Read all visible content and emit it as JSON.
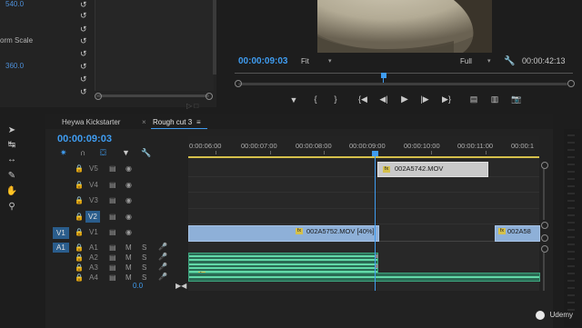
{
  "effect_controls": {
    "rows": [
      {
        "label": "",
        "value": "540.0"
      },
      {
        "label": "",
        "value": ""
      },
      {
        "label": "orm Scale",
        "value": ""
      },
      {
        "label": "",
        "value": ""
      },
      {
        "label": "",
        "value": "360.0"
      },
      {
        "label": "",
        "value": ""
      },
      {
        "label": "",
        "value": ""
      }
    ]
  },
  "program_monitor": {
    "timecode": "00:00:09:03",
    "fit": "Fit",
    "resolution": "Full",
    "duration": "00:00:42:13",
    "controls": [
      "marker-icon",
      "in-point-icon",
      "out-point-icon",
      "go-to-in-icon",
      "step-back-icon",
      "play-icon",
      "step-forward-icon",
      "go-to-out-icon",
      "lift-icon",
      "extract-icon",
      "export-frame-icon"
    ]
  },
  "timeline": {
    "tabs": [
      {
        "label": "Heywa Kickstarter"
      },
      {
        "label": "Rough cut 3"
      }
    ],
    "timecode": "00:00:09:03",
    "ruler": [
      "0:00:06:00",
      "00:00:07:00",
      "00:00:08:00",
      "00:00:09:00",
      "00:00:10:00",
      "00:00:11:00",
      "00:00:1"
    ],
    "video_tracks": [
      "V5",
      "V4",
      "V3",
      "V2",
      "V1"
    ],
    "audio_tracks": [
      "A1",
      "A2",
      "A3",
      "A4"
    ],
    "source_v": "V1",
    "source_a": "A1",
    "master_value": "0.0",
    "clips": {
      "v5_clip": "002A5742.MOV",
      "v1_clip": "002A5752.MOV [40%]",
      "v1_clip2": "002A58"
    },
    "track_btn": {
      "mute": "M",
      "solo": "S"
    }
  },
  "watermark": "Udemy"
}
